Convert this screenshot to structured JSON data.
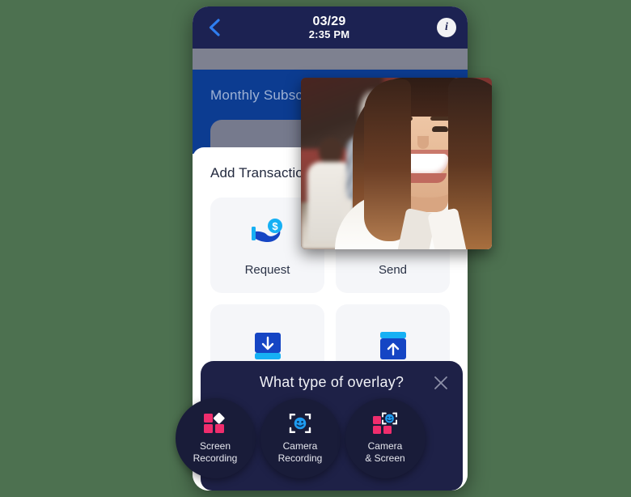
{
  "theme": {
    "page_background": "#4d7150",
    "app_header_bg": "#1c2252",
    "blue_panel_bg": "#0c3c91",
    "gray_band_bg": "#7e8190",
    "dialog_bg": "#1e2147",
    "option_circle_bg": "#191c39",
    "accent_blue": "#1464f6",
    "accent_cyan": "#16b0f4",
    "accent_pink": "#ef2d6d",
    "tile_bg": "#f5f6f9"
  },
  "phone_app": {
    "header": {
      "back_icon": "chevron-left-icon",
      "date": "03/29",
      "time": "2:35 PM",
      "info_icon": "info-icon",
      "info_glyph": "i"
    },
    "blue_panel": {
      "title": "Monthly Subscription"
    },
    "transaction_sheet": {
      "title": "Add Transaction",
      "tiles": [
        {
          "label": "Request",
          "icon": "hand-holding-dollar-icon"
        },
        {
          "label": "Send",
          "icon": "paper-plane-icon"
        },
        {
          "label": "",
          "icon": "deposit-download-icon"
        },
        {
          "label": "",
          "icon": "withdraw-upload-icon"
        }
      ]
    }
  },
  "video_overlay": {
    "name": "camera-pip-preview",
    "description": "Live camera preview of a smiling woman with two blurred people in a red-walled room behind her"
  },
  "dialog": {
    "title": "What type of overlay?",
    "close_icon": "close-icon",
    "options": [
      {
        "id": "screen-recording",
        "label": "Screen\nRecording",
        "icon": "screen-squares-icon"
      },
      {
        "id": "camera-recording",
        "label": "Camera\nRecording",
        "icon": "camera-face-bracket-icon"
      },
      {
        "id": "camera-and-screen",
        "label": "Camera\n& Screen",
        "icon": "camera-and-screen-icon"
      }
    ]
  }
}
